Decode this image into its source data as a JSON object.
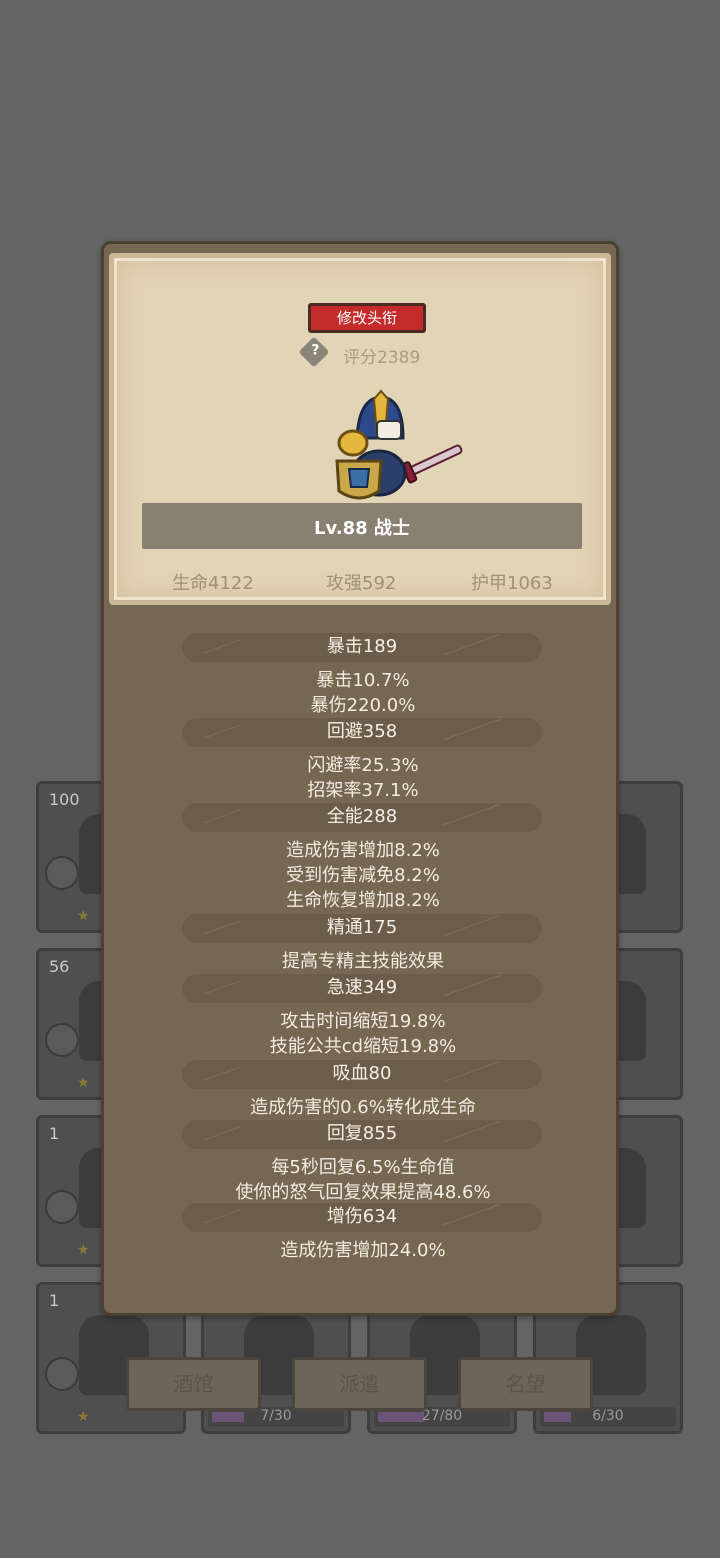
{
  "background": {
    "cards": [
      {
        "count": "100"
      },
      {
        "count": "56"
      },
      {
        "count": "1"
      },
      {
        "count": "1"
      }
    ],
    "bottom_cards": [
      {
        "progress_text": "7/30",
        "progress": 0.233
      },
      {
        "progress_text": "27/80",
        "progress": 0.3375
      },
      {
        "progress_text": "6/30",
        "progress": 0.2
      }
    ],
    "buttons": [
      "酒馆",
      "派遣",
      "名望"
    ]
  },
  "dialog": {
    "title_button": "修改头衔",
    "help_icon": "?",
    "score": "评分2389",
    "level": "Lv.88 战士",
    "base_stats": {
      "hp": "生命4122",
      "atk": "攻强592",
      "armor": "护甲1063"
    },
    "stats": [
      {
        "label": "暴击189",
        "lines": [
          "暴击10.7%",
          "暴伤220.0%"
        ]
      },
      {
        "label": "回避358",
        "lines": [
          "闪避率25.3%",
          "招架率37.1%"
        ]
      },
      {
        "label": "全能288",
        "lines": [
          "造成伤害增加8.2%",
          "受到伤害减免8.2%",
          "生命恢复增加8.2%"
        ]
      },
      {
        "label": "精通175",
        "lines": [
          "提高专精主技能效果"
        ]
      },
      {
        "label": "急速349",
        "lines": [
          "攻击时间缩短19.8%",
          "技能公共cd缩短19.8%"
        ]
      },
      {
        "label": "吸血80",
        "lines": [
          "造成伤害的0.6%转化成生命"
        ]
      },
      {
        "label": "回复855",
        "lines": [
          "每5秒回复6.5%生命值",
          "使你的怒气回复效果提高48.6%"
        ]
      },
      {
        "label": "增伤634",
        "lines": [
          "造成伤害增加24.0%"
        ]
      }
    ]
  }
}
